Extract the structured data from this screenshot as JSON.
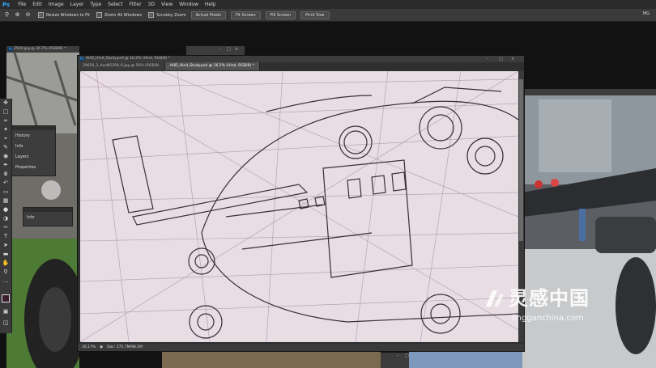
{
  "app": {
    "logo": "Ps"
  },
  "menu": [
    "File",
    "Edit",
    "Image",
    "Layer",
    "Type",
    "Select",
    "Filter",
    "3D",
    "View",
    "Window",
    "Help"
  ],
  "options": {
    "zoom_icons": [
      "zoom-tool-icon",
      "zoom-in-icon",
      "zoom-out-icon"
    ],
    "checks": [
      {
        "label": "Resize Windows to Fit",
        "checked": true
      },
      {
        "label": "Zoom All Windows",
        "checked": false
      },
      {
        "label": "Scrubby Zoom",
        "checked": true
      }
    ],
    "buttons": [
      "Actual Pixels",
      "Fit Screen",
      "Fill Screen",
      "Print Size"
    ],
    "workspace": "MG"
  },
  "windows": {
    "back_left": {
      "title": "2504.jpg @ 36.7% (RGB/8) *"
    },
    "back_right": {
      "title": ""
    }
  },
  "panels": {
    "history": [
      "History",
      "Info",
      "Layers",
      "Properties"
    ],
    "info": "Info"
  },
  "document": {
    "top_label": "AHD_Hind_Study.psd @ 16.2% (Hind, RGB/8) *",
    "tabs": [
      {
        "label": "29650_2_AvaN5299_6.jpg @ 50% (RGB/8)",
        "active": false
      },
      {
        "label": "AHD_Hind_Study.psd @ 16.2% (Hind, RGB/8) *",
        "active": true
      }
    ],
    "zoom": "16.17%",
    "doc_size": "Doc: 171.7M/98.1M"
  },
  "watermark": {
    "cn": "灵感中国",
    "url": "lingganchina.com"
  },
  "colors": {
    "accent": "#31a8ff",
    "canvas": "#e7dde2",
    "sketch": "#3a2e3a"
  }
}
